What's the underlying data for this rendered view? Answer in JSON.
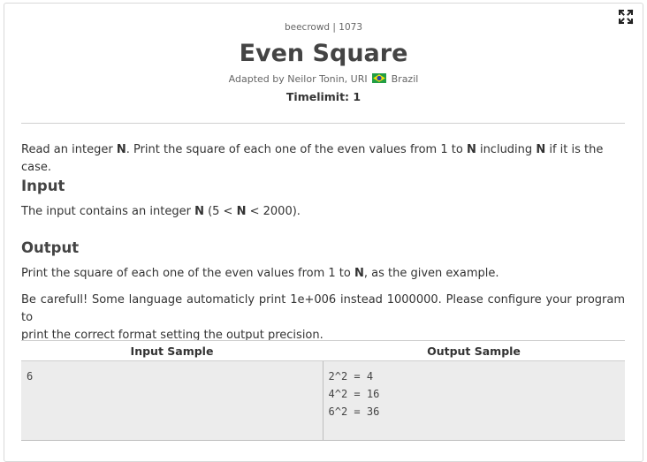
{
  "header": {
    "breadcrumb": "beecrowd | 1073",
    "title": "Even Square",
    "author_prefix": "Adapted by Neilor Tonin, URI",
    "country": "Brazil",
    "timelimit": "Timelimit: 1"
  },
  "statement": {
    "parts": [
      "Read an integer ",
      "N",
      ". Print the square of each one of the even values from 1 to ",
      "N",
      " including ",
      "N",
      " if it is the case."
    ]
  },
  "input_section": {
    "heading": "Input",
    "parts": [
      "The input contains an integer ",
      "N",
      " (5 < ",
      "N",
      " < 2000)."
    ]
  },
  "output_section": {
    "heading": "Output",
    "parts": [
      "Print the square of each one of the even values from 1 to ",
      "N",
      ", as the given example."
    ],
    "note_line1": "Be carefull! Some language automaticly print 1e+006 instead 1000000. Please configure your program to",
    "note_line2": "print the correct format setting the output precision."
  },
  "samples": {
    "input_header": "Input Sample",
    "output_header": "Output Sample",
    "input_lines": [
      "6"
    ],
    "output_lines": [
      "2^2 = 4",
      "4^2 = 16",
      "6^2 = 36"
    ]
  },
  "icons": {
    "expand": "expand-icon",
    "flag": "brazil-flag-icon"
  },
  "colors": {
    "flag_green": "#229e45",
    "flag_yellow": "#f8e509",
    "flag_blue": "#2b49a3"
  }
}
